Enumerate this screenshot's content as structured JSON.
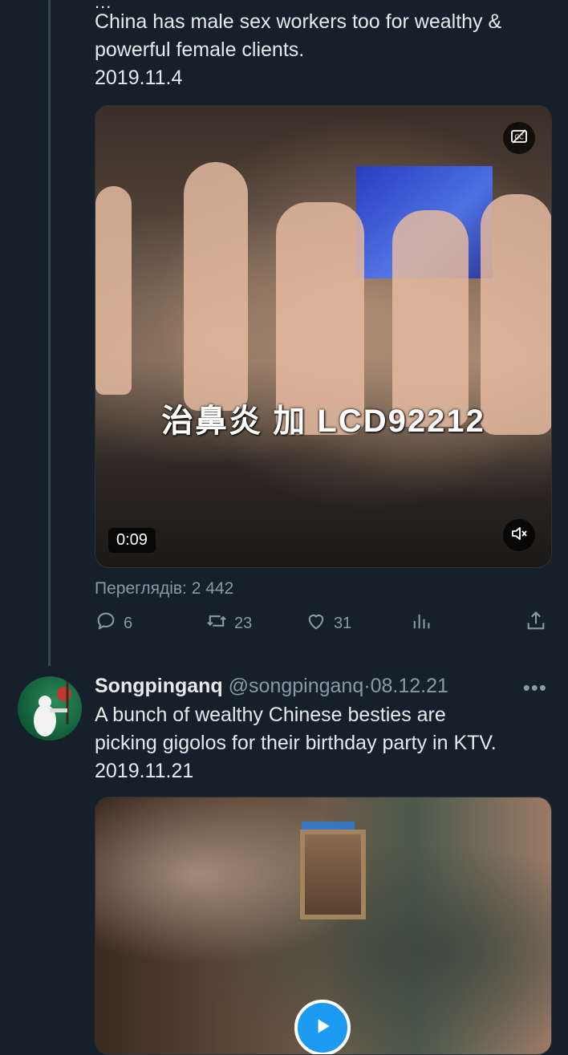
{
  "tweet1": {
    "top_ellipsis": "...",
    "text_lines": [
      "China has male sex workers too for wealthy &",
      "powerful female clients.",
      "2019.11.4"
    ],
    "video": {
      "subtitle": "治鼻炎 加 LCD92212",
      "duration": "0:09",
      "cc_icon": "closed-captions-icon",
      "mute_icon": "speaker-muted-icon"
    },
    "views_label": "Переглядів: 2 442",
    "actions": {
      "replies": "6",
      "retweets": "23",
      "likes": "31"
    }
  },
  "tweet2": {
    "author_name": "Songpinganq",
    "author_handle": "@songpinganq",
    "separator": "·",
    "date": "08.12.21",
    "more_label": "•••",
    "text_lines": [
      "A bunch of wealthy Chinese besties are",
      "picking gigolos for their birthday party in KTV.",
      "2019.11.21"
    ]
  },
  "colors": {
    "background": "#15202b",
    "text_primary": "#e7e9ea",
    "text_secondary": "#8b98a5",
    "accent": "#1d9bf0"
  }
}
